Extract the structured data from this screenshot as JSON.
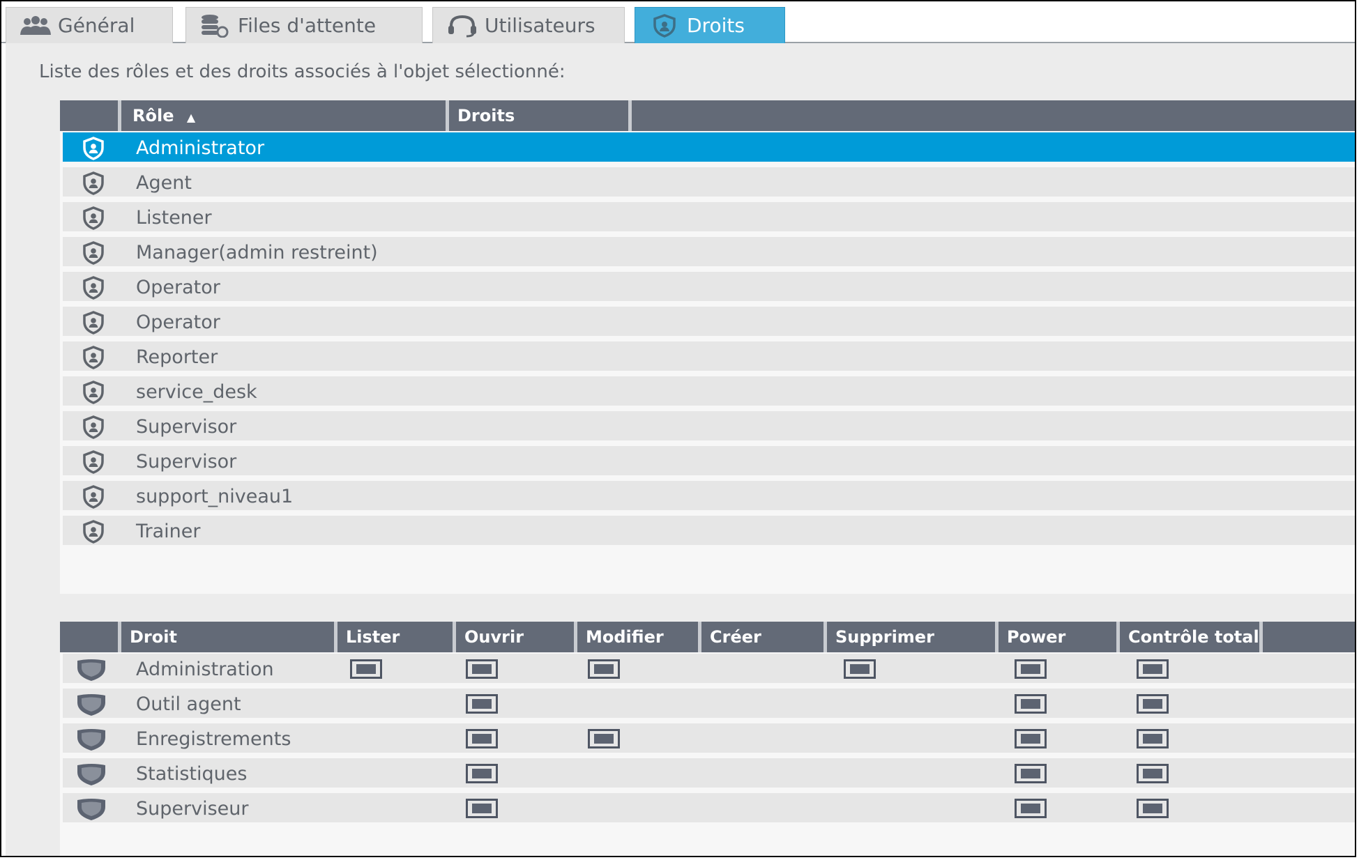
{
  "tabs": [
    {
      "label": "Général",
      "icon": "users-icon"
    },
    {
      "label": "Files d'attente",
      "icon": "queue-icon"
    },
    {
      "label": "Utilisateurs",
      "icon": "headset-icon"
    },
    {
      "label": "Droits",
      "icon": "shield-icon",
      "active": true
    }
  ],
  "intro": "Liste des rôles et des droits associés à l'objet sélectionné:",
  "roles_table": {
    "headers": {
      "role": "Rôle",
      "sort_indicator": "▲",
      "droits": "Droits"
    },
    "rows": [
      {
        "label": "Administrator",
        "selected": true
      },
      {
        "label": "Agent"
      },
      {
        "label": "Listener"
      },
      {
        "label": "Manager(admin restreint)"
      },
      {
        "label": "Operator"
      },
      {
        "label": "Operator"
      },
      {
        "label": "Reporter"
      },
      {
        "label": "service_desk"
      },
      {
        "label": "Supervisor"
      },
      {
        "label": "Supervisor"
      },
      {
        "label": "support_niveau1"
      },
      {
        "label": "Trainer"
      }
    ]
  },
  "rights_table": {
    "headers": [
      "Droit",
      "Lister",
      "Ouvrir",
      "Modifier",
      "Créer",
      "Supprimer",
      "Power",
      "Contrôle total"
    ],
    "rows": [
      {
        "label": "Administration",
        "checked": [
          "lister",
          "ouvrir",
          "modifier",
          "supprimer",
          "power",
          "controle_total"
        ]
      },
      {
        "label": "Outil agent",
        "checked": [
          "ouvrir",
          "power",
          "controle_total"
        ]
      },
      {
        "label": "Enregistrements",
        "checked": [
          "ouvrir",
          "modifier",
          "power",
          "controle_total"
        ]
      },
      {
        "label": "Statistiques",
        "checked": [
          "ouvrir",
          "power",
          "controle_total"
        ]
      },
      {
        "label": "Superviseur",
        "checked": [
          "ouvrir",
          "power",
          "controle_total"
        ]
      }
    ]
  },
  "colors": {
    "accent": "#009bd8",
    "tab_active": "#42aedb",
    "header": "#636a77"
  }
}
